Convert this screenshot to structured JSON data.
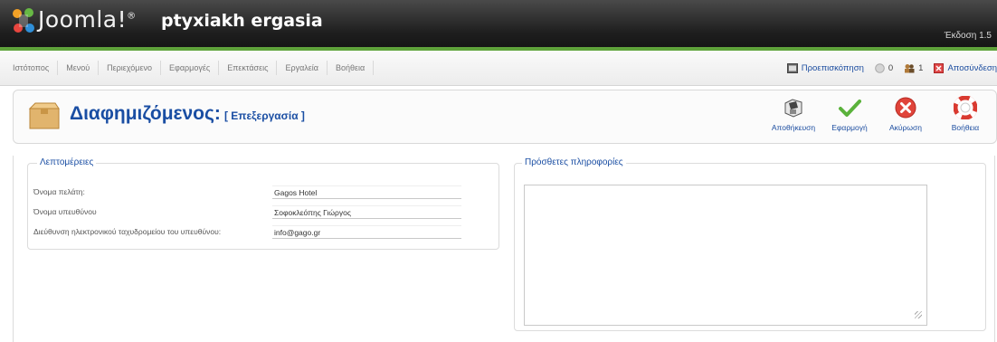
{
  "header": {
    "logo_text": "Joomla!",
    "logo_mark": "®",
    "site_name": "ptyxiakh ergasia",
    "version": "Έκδοση 1.5"
  },
  "menu": {
    "items": [
      "Ιστότοπος",
      "Μενού",
      "Περιεχόμενο",
      "Εφαρμογές",
      "Επεκτάσεις",
      "Εργαλεία",
      "Βοήθεια"
    ]
  },
  "status": {
    "preview_label": "Προεπισκόπηση",
    "messages_count": "0",
    "users_count": "1",
    "logout_label": "Αποσύνδεση"
  },
  "toolbar": {
    "title": "Διαφημιζόμενος:",
    "subtitle": "[ Επεξεργασία ]",
    "buttons": [
      {
        "label": "Αποθήκευση",
        "icon": "save-icon"
      },
      {
        "label": "Εφαρμογή",
        "icon": "apply-icon"
      },
      {
        "label": "Ακύρωση",
        "icon": "cancel-icon"
      },
      {
        "label": "Βοήθεια",
        "icon": "help-icon"
      }
    ]
  },
  "details": {
    "legend": "Λεπτομέρειες",
    "fields": [
      {
        "label": "Όνομα πελάτη:",
        "value": "Gagos Hotel"
      },
      {
        "label": "Όνομα υπευθύνου",
        "value": "Σοφοκλεόπης Γιώργος"
      },
      {
        "label": "Διεύθυνση ηλεκτρονικού ταχυδρομείου του υπευθύνου:",
        "value": "info@gago.gr"
      }
    ]
  },
  "extra_info": {
    "legend": "Πρόσθετες πληροφορίες",
    "value": ""
  },
  "colors": {
    "header_bg": "#1e1e1e",
    "accent_green": "#5fa33b",
    "link_blue": "#1a4ea3"
  }
}
